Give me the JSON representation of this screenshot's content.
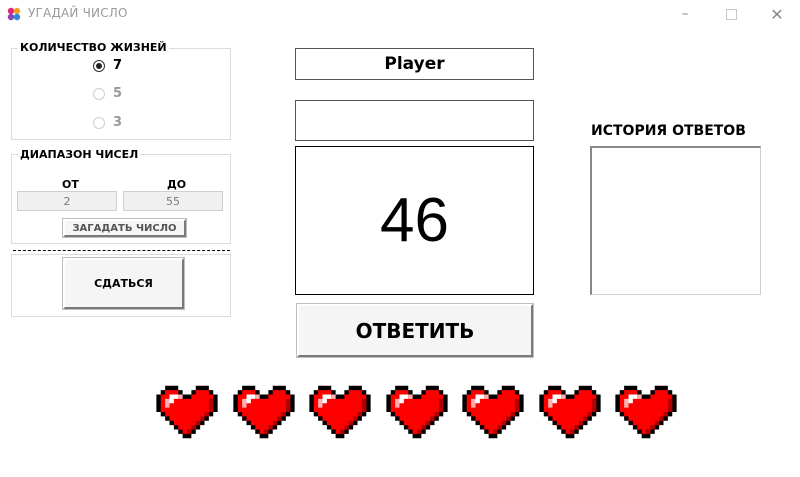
{
  "window": {
    "title": "УГАДАЙ ЧИСЛО",
    "minimize_icon": "minimize-icon",
    "maximize_icon": "maximize-icon",
    "close_icon": "close-icon"
  },
  "lives_group": {
    "title": "КОЛИЧЕСТВО ЖИЗНЕЙ",
    "options": [
      {
        "label": "7",
        "checked": true
      },
      {
        "label": "5",
        "checked": false
      },
      {
        "label": "3",
        "checked": false
      }
    ]
  },
  "range_group": {
    "title": "ДИАПАЗОН ЧИСЕЛ",
    "from_label": "ОТ",
    "to_label": "ДО",
    "from_value": "2",
    "to_value": "55",
    "generate_button": "ЗАГАДАТЬ ЧИСЛО"
  },
  "give_up_button": "СДАТЬСЯ",
  "player_name": "Player",
  "answer_input": {
    "value": ""
  },
  "guess_display": "46",
  "answer_button": "ОТВЕТИТЬ",
  "history": {
    "title": "ИСТОРИЯ ОТВЕТОВ",
    "items": []
  },
  "lives": {
    "count": 7,
    "max": 7,
    "icon": "heart-icon",
    "color": "#ff0000"
  }
}
